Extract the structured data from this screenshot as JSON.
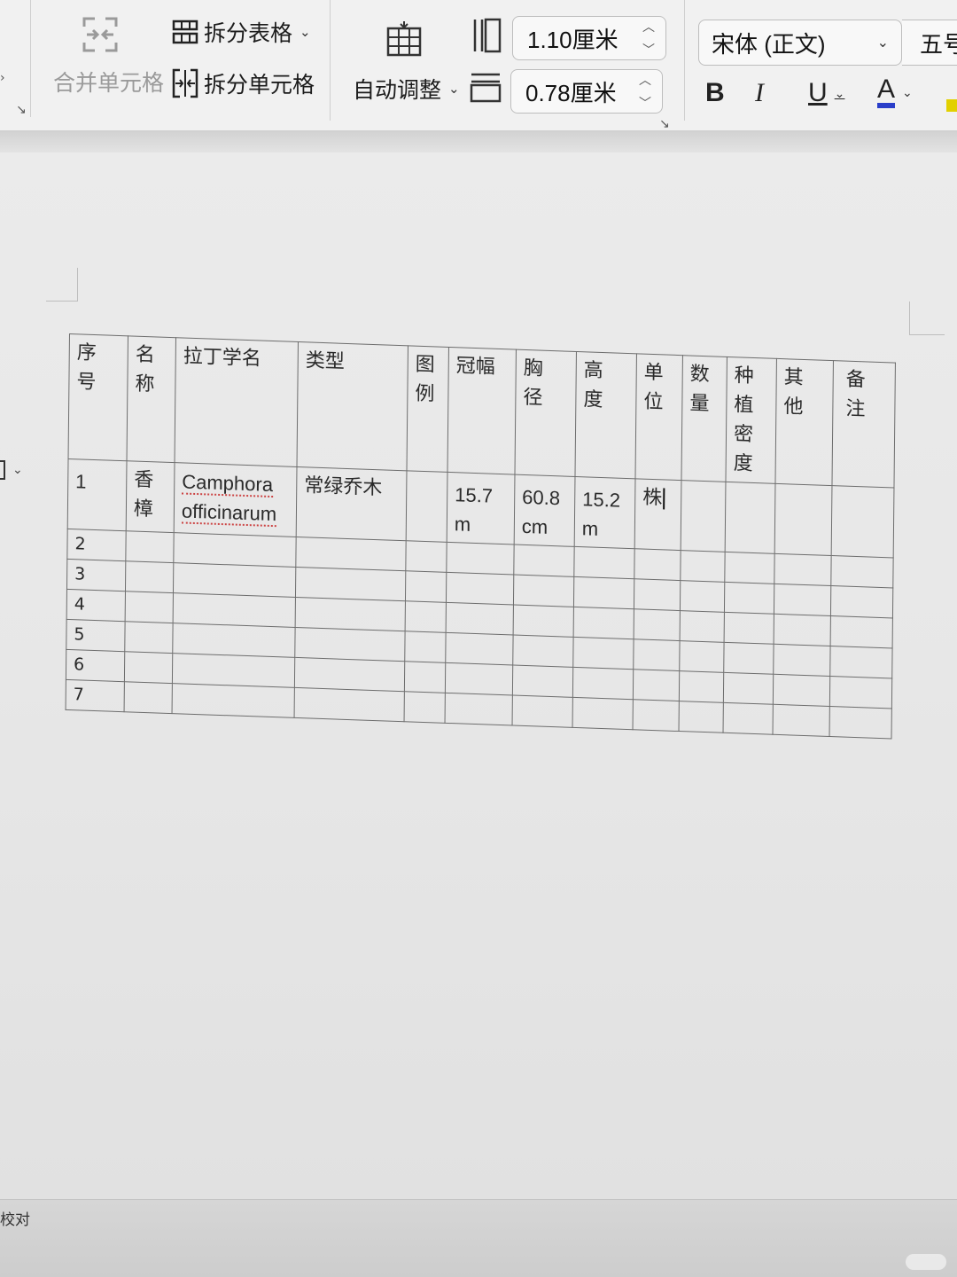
{
  "ribbon": {
    "merge_cells": "合并单元格",
    "split_table": "拆分表格",
    "split_cells": "拆分单元格",
    "auto_fit": "自动调整",
    "row_height": "1.10厘米",
    "col_width": "0.78厘米",
    "font_name": "宋体 (正文)",
    "font_size": "五号",
    "bold": "B",
    "italic": "I",
    "underline": "U",
    "font_color": "A",
    "font_color_hex": "#2a3ec9"
  },
  "table": {
    "headers": [
      "序号",
      "名称",
      "拉丁学名",
      "类型",
      "图例",
      "冠幅",
      "胸径",
      "高度",
      "单位",
      "数量",
      "种植密度",
      "其他",
      "备注"
    ],
    "row1": {
      "index": "1",
      "name": "香樟",
      "latin_1": "Camphora",
      "latin_2": "officinarum",
      "type": "常绿乔木",
      "legend": "",
      "crown_1": "15.7",
      "crown_2": "m",
      "dbh_1": "60.8",
      "dbh_2": "cm",
      "height_1": "15.2",
      "height_2": "m",
      "unit": "株"
    },
    "row_numbers": [
      "2",
      "3",
      "4",
      "5",
      "6",
      "7"
    ]
  },
  "status": {
    "proofread": "校对"
  }
}
